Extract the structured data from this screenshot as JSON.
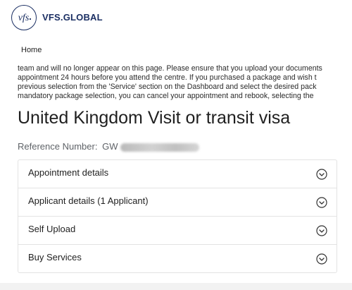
{
  "header": {
    "logo_icon": "vfs-logo-icon",
    "brand_name": "VFS.GLOBAL"
  },
  "nav": {
    "home_label": "Home"
  },
  "notice": {
    "lines": [
      "team and will no longer appear on this page. Please ensure that you upload your documents",
      "appointment 24 hours before you attend the centre. If you purchased a package and wish t",
      "previous selection from the 'Service' section on the Dashboard and select the desired pack",
      "mandatory package selection, you can cancel your appointment and rebook, selecting the"
    ]
  },
  "title": "United Kingdom Visit or transit visa",
  "reference": {
    "label": "Reference Number:",
    "visible_prefix": "GW"
  },
  "accordion": {
    "items": [
      {
        "label": "Appointment details",
        "icon": "chevron-down-circle-icon"
      },
      {
        "label": "Applicant details (1 Applicant)",
        "icon": "chevron-down-circle-icon"
      },
      {
        "label": "Self Upload",
        "icon": "chevron-down-circle-icon"
      },
      {
        "label": "Buy Services",
        "icon": "chevron-down-circle-icon"
      }
    ]
  },
  "colors": {
    "brand": "#1b2f63",
    "text": "#1f1f1f",
    "muted": "#5f6368",
    "border": "#e3e3e3"
  }
}
